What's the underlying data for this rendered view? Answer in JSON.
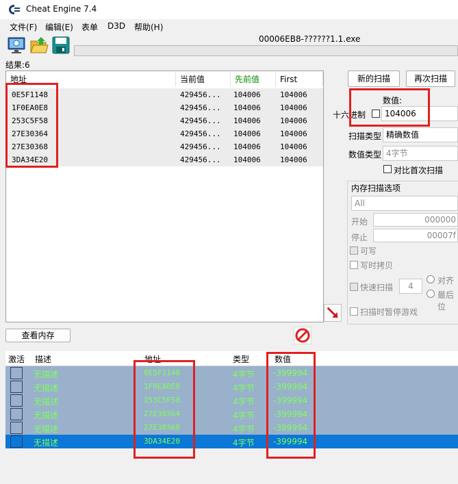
{
  "window": {
    "title": "Cheat Engine 7.4"
  },
  "menu": [
    "文件(F)",
    "编辑(E)",
    "表单",
    "D3D",
    "帮助(H)"
  ],
  "process": {
    "name": "00006EB8-??????1.1.exe"
  },
  "results": {
    "label": "结果:6",
    "columns": [
      "地址",
      "当前值",
      "先前值",
      "First"
    ],
    "rows": [
      {
        "address": "0E5F1148",
        "current": "429456...",
        "previous": "104006",
        "first": "104006"
      },
      {
        "address": "1F0EA0E8",
        "current": "429456...",
        "previous": "104006",
        "first": "104006"
      },
      {
        "address": "253C5F58",
        "current": "429456...",
        "previous": "104006",
        "first": "104006"
      },
      {
        "address": "27E30364",
        "current": "429456...",
        "previous": "104006",
        "first": "104006"
      },
      {
        "address": "27E30368",
        "current": "429456...",
        "previous": "104006",
        "first": "104006"
      },
      {
        "address": "3DA34E20",
        "current": "429456...",
        "previous": "104006",
        "first": "104006"
      }
    ]
  },
  "scan": {
    "new_scan": "新的扫描",
    "next_scan": "再次扫描",
    "value_label": "数值:",
    "hex_label": "十六进制",
    "value": "104006",
    "scan_type_label": "扫描类型",
    "scan_type": "精确数值",
    "value_type_label": "数值类型",
    "value_type": "4字节",
    "compare_first": "对比首次扫描",
    "memory_options_label": "内存扫描选项",
    "memory_region": "All",
    "start_label": "开始",
    "start_value": "000000",
    "stop_label": "停止",
    "stop_value": "00007f",
    "writable": "可写",
    "copy_on_write": "写时拷贝",
    "fast_scan": "快速扫描",
    "fast_scan_value": "4",
    "align": "对齐",
    "last_digits": "最后位",
    "pause_game": "扫描时暂停游戏"
  },
  "view_memory": "查看内存",
  "table": {
    "columns": [
      "激活",
      "描述",
      "地址",
      "类型",
      "数值"
    ],
    "rows": [
      {
        "description": "无描述",
        "address": "0E5F1148",
        "type": "4字节",
        "value": "-399994"
      },
      {
        "description": "无描述",
        "address": "1F0EA0E8",
        "type": "4字节",
        "value": "-399994"
      },
      {
        "description": "无描述",
        "address": "253C5F58",
        "type": "4字节",
        "value": "-399994"
      },
      {
        "description": "无描述",
        "address": "27E30364",
        "type": "4字节",
        "value": "-399994"
      },
      {
        "description": "无描述",
        "address": "27E30368",
        "type": "4字节",
        "value": "-399994"
      },
      {
        "description": "无描述",
        "address": "3DA34E20",
        "type": "4字节",
        "value": "-399994"
      }
    ]
  },
  "colors": {
    "highlight_red": "#e02020",
    "row_bg": "#9ab1cc",
    "row_selected": "#0b77d6",
    "row_text": "#7dff5a",
    "previous_header": "#0a8a0a"
  }
}
